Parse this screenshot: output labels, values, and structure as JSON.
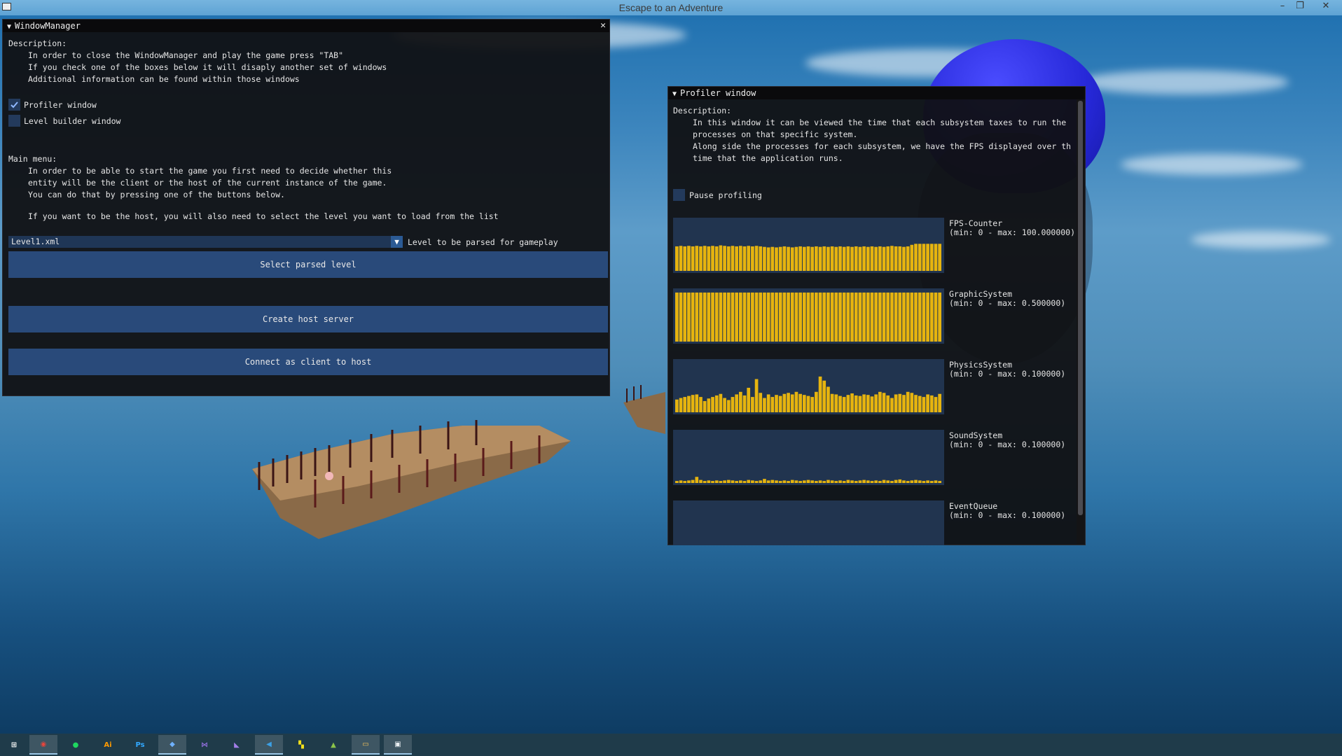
{
  "app": {
    "title": "Escape to an Adventure"
  },
  "window_manager": {
    "title": "WindowManager",
    "description_label": "Description:",
    "description_lines": [
      "In order to close the WindowManager and play the game press \"TAB\"",
      "If you check one of the boxes below it will disaply another set of windows",
      "Additional information can be found within those windows"
    ],
    "checkboxes": [
      {
        "label": "Profiler window",
        "checked": true
      },
      {
        "label": "Level builder window",
        "checked": false
      }
    ],
    "main_menu_label": "Main menu:",
    "main_menu_lines": [
      "In order to be able to start the game you first need to decide whether this",
      "entity will be the client or the host of the current instance of the game.",
      "You can do that by pressing one of the buttons below."
    ],
    "host_hint": "If you want to be the host, you will also need to select the level you want to load from the list",
    "combo": {
      "value": "Level1.xml",
      "label": "Level to be parsed for gameplay"
    },
    "buttons": {
      "select_level": "Select parsed level",
      "create_host": "Create host server",
      "connect_client": "Connect as client to host"
    }
  },
  "profiler": {
    "title": "Profiler window",
    "description_label": "Description:",
    "description_lines": [
      "In this window it can be viewed the time that each subsystem taxes to run the",
      "processes on that specific system.",
      "Along side the processes for each subsystem, we have the FPS displayed over th",
      "time that the application runs."
    ],
    "pause_label": "Pause profiling",
    "pause_checked": false,
    "plots": [
      {
        "name": "FPS-Counter",
        "range": "(min: 0 - max: 100.000000)",
        "min": 0,
        "max": 100,
        "values": [
          48,
          49,
          48,
          49,
          48,
          49,
          48,
          49,
          48,
          49,
          48,
          50,
          49,
          48,
          49,
          48,
          49,
          48,
          49,
          48,
          49,
          48,
          47,
          46,
          47,
          46,
          47,
          48,
          47,
          46,
          47,
          48,
          47,
          48,
          47,
          48,
          47,
          48,
          47,
          48,
          47,
          48,
          47,
          48,
          47,
          48,
          47,
          48,
          47,
          48,
          47,
          48,
          47,
          48,
          49,
          48,
          48,
          47,
          48,
          51,
          53,
          53,
          53,
          53,
          53,
          53,
          53
        ]
      },
      {
        "name": "GraphicSystem",
        "range": "(min: 0 - max: 0.500000)",
        "min": 0,
        "max": 0.5,
        "values": [
          0.48,
          0.48,
          0.48,
          0.48,
          0.48,
          0.48,
          0.48,
          0.48,
          0.48,
          0.48,
          0.48,
          0.48,
          0.48,
          0.48,
          0.48,
          0.48,
          0.48,
          0.48,
          0.48,
          0.48,
          0.48,
          0.48,
          0.48,
          0.48,
          0.48,
          0.48,
          0.48,
          0.48,
          0.48,
          0.48,
          0.48,
          0.48,
          0.48,
          0.48,
          0.48,
          0.48,
          0.48,
          0.48,
          0.48,
          0.48,
          0.48,
          0.48,
          0.48,
          0.48,
          0.48,
          0.48,
          0.48,
          0.48,
          0.48,
          0.48,
          0.48,
          0.48,
          0.48,
          0.48,
          0.48,
          0.48,
          0.48,
          0.48,
          0.48,
          0.48,
          0.48,
          0.48,
          0.48,
          0.48,
          0.48,
          0.48,
          0.48
        ]
      },
      {
        "name": "PhysicsSystem",
        "range": "(min: 0 - max: 0.100000)",
        "min": 0,
        "max": 0.1,
        "values": [
          0.025,
          0.028,
          0.03,
          0.032,
          0.034,
          0.035,
          0.03,
          0.022,
          0.027,
          0.03,
          0.033,
          0.036,
          0.028,
          0.024,
          0.03,
          0.035,
          0.04,
          0.033,
          0.048,
          0.03,
          0.065,
          0.038,
          0.028,
          0.035,
          0.03,
          0.034,
          0.032,
          0.036,
          0.038,
          0.035,
          0.04,
          0.036,
          0.034,
          0.032,
          0.03,
          0.04,
          0.07,
          0.062,
          0.05,
          0.036,
          0.035,
          0.032,
          0.03,
          0.034,
          0.037,
          0.033,
          0.032,
          0.035,
          0.034,
          0.031,
          0.035,
          0.04,
          0.038,
          0.033,
          0.028,
          0.035,
          0.036,
          0.034,
          0.04,
          0.038,
          0.034,
          0.032,
          0.03,
          0.035,
          0.033,
          0.03,
          0.036
        ]
      },
      {
        "name": "SoundSystem",
        "range": "(min: 0 - max: 0.100000)",
        "min": 0,
        "max": 0.1,
        "values": [
          0.004,
          0.005,
          0.004,
          0.005,
          0.006,
          0.012,
          0.006,
          0.004,
          0.005,
          0.004,
          0.005,
          0.004,
          0.005,
          0.006,
          0.005,
          0.004,
          0.005,
          0.004,
          0.006,
          0.005,
          0.004,
          0.005,
          0.008,
          0.005,
          0.006,
          0.005,
          0.004,
          0.005,
          0.004,
          0.006,
          0.005,
          0.004,
          0.005,
          0.006,
          0.005,
          0.004,
          0.005,
          0.004,
          0.006,
          0.005,
          0.004,
          0.005,
          0.004,
          0.006,
          0.005,
          0.004,
          0.005,
          0.006,
          0.005,
          0.004,
          0.005,
          0.004,
          0.006,
          0.005,
          0.004,
          0.006,
          0.007,
          0.005,
          0.004,
          0.005,
          0.006,
          0.005,
          0.004,
          0.005,
          0.004,
          0.005,
          0.004
        ]
      },
      {
        "name": "EventQueue",
        "range": "(min: 0 - max: 0.100000)",
        "min": 0,
        "max": 0.1,
        "values": []
      }
    ],
    "colors": {
      "bar": "#e6b40f",
      "plot_bg": "#21344f"
    }
  },
  "taskbar": {
    "items": [
      {
        "name": "start-icon",
        "glyph": "⊞",
        "color": "#ffffff",
        "active": false
      },
      {
        "name": "chrome-icon",
        "glyph": "◉",
        "color": "#e8453c",
        "active": true
      },
      {
        "name": "spotify-icon",
        "glyph": "●",
        "color": "#1ed760",
        "active": false
      },
      {
        "name": "illustrator-icon",
        "glyph": "Ai",
        "color": "#ff9a00",
        "active": false
      },
      {
        "name": "photoshop-icon",
        "glyph": "Ps",
        "color": "#31a8ff",
        "active": false
      },
      {
        "name": "sourcetree-icon",
        "glyph": "◆",
        "color": "#6fb1ff",
        "active": true
      },
      {
        "name": "visual-studio-icon",
        "glyph": "⋈",
        "color": "#8c6cd6",
        "active": false
      },
      {
        "name": "visual-studio-2-icon",
        "glyph": "◣",
        "color": "#a27ee8",
        "active": false
      },
      {
        "name": "vscode-icon",
        "glyph": "◀",
        "color": "#3ba0e6",
        "active": true
      },
      {
        "name": "pycharm-icon",
        "glyph": "▚",
        "color": "#f5e01b",
        "active": false
      },
      {
        "name": "android-icon",
        "glyph": "▲",
        "color": "#8bc34a",
        "active": false
      },
      {
        "name": "explorer-icon",
        "glyph": "▭",
        "color": "#f2c35c",
        "active": true
      },
      {
        "name": "game-window-icon",
        "glyph": "▣",
        "color": "#e9eef2",
        "active": true
      }
    ]
  }
}
